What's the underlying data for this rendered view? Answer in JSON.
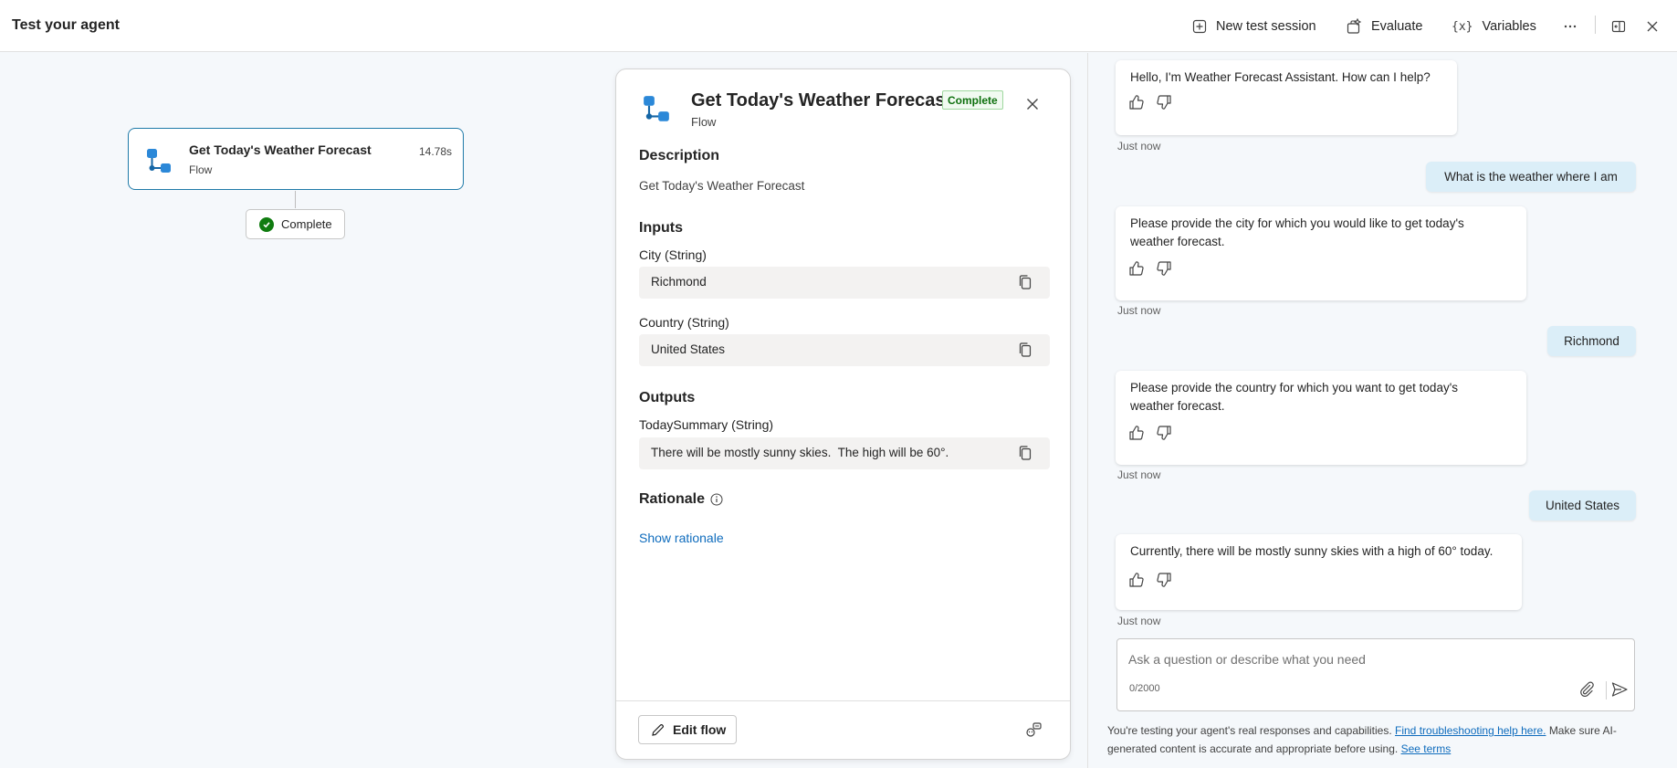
{
  "header": {
    "title": "Test your agent",
    "new_session_label": "New test session",
    "evaluate_label": "Evaluate",
    "variables_label": "Variables"
  },
  "canvas": {
    "node": {
      "title": "Get Today's Weather Forecast",
      "subtitle": "Flow",
      "time": "14.78s"
    },
    "status_chip": "Complete"
  },
  "panel": {
    "title": "Get Today's Weather Forecast",
    "badge": "Complete",
    "subtitle": "Flow",
    "description_heading": "Description",
    "description_text": "Get Today's Weather Forecast",
    "inputs_heading": "Inputs",
    "inputs": [
      {
        "label": "City (String)",
        "value": "Richmond"
      },
      {
        "label": "Country (String)",
        "value": "United States"
      }
    ],
    "outputs_heading": "Outputs",
    "outputs": [
      {
        "label": "TodaySummary (String)",
        "value": "There will be mostly sunny skies.  The high will be 60°."
      }
    ],
    "rationale_heading": "Rationale",
    "show_rationale": "Show rationale",
    "edit_flow_label": "Edit flow"
  },
  "chat": {
    "messages": [
      {
        "role": "bot",
        "lines": [
          "Hello, I'm Weather Forecast Assistant. How can I help?"
        ],
        "time": "Just now"
      },
      {
        "role": "user",
        "text": "What is the weather where I am"
      },
      {
        "role": "bot",
        "lines": [
          "Please provide the city for which you would like to get today's",
          "weather forecast."
        ],
        "time": "Just now"
      },
      {
        "role": "user",
        "text": "Richmond"
      },
      {
        "role": "bot",
        "lines": [
          "Please provide the country for which you want to get today's",
          "weather forecast."
        ],
        "time": "Just now"
      },
      {
        "role": "user",
        "text": "United States"
      },
      {
        "role": "bot",
        "lines": [
          "Currently, there will be mostly sunny skies with a high of 60° today."
        ],
        "time": "Just now"
      }
    ],
    "input_placeholder": "Ask a question or describe what you need",
    "char_count": "0/2000",
    "disclaimer": {
      "prefix": "You're testing your agent's real responses and capabilities.",
      "help_link": "Find troubleshooting help here.",
      "middle": "Make sure AI-",
      "line2": "generated content is accurate and appropriate before using.",
      "terms_link": "See terms"
    }
  },
  "colors": {
    "accent": "#0f6cbd",
    "node_border": "#1f7aa8",
    "success": "#107c10",
    "user_bubble": "#dbeef8",
    "flow_icon": "#2b88d8"
  },
  "icons": [
    "add-square-icon",
    "evaluate-icon",
    "variables-icon",
    "more-icon",
    "panel-toggle-icon",
    "close-icon",
    "flow-icon",
    "check-icon",
    "copy-icon",
    "info-icon",
    "pencil-icon",
    "agent-icon",
    "thumbs-up-icon",
    "thumbs-down-icon",
    "attach-icon",
    "send-icon"
  ]
}
